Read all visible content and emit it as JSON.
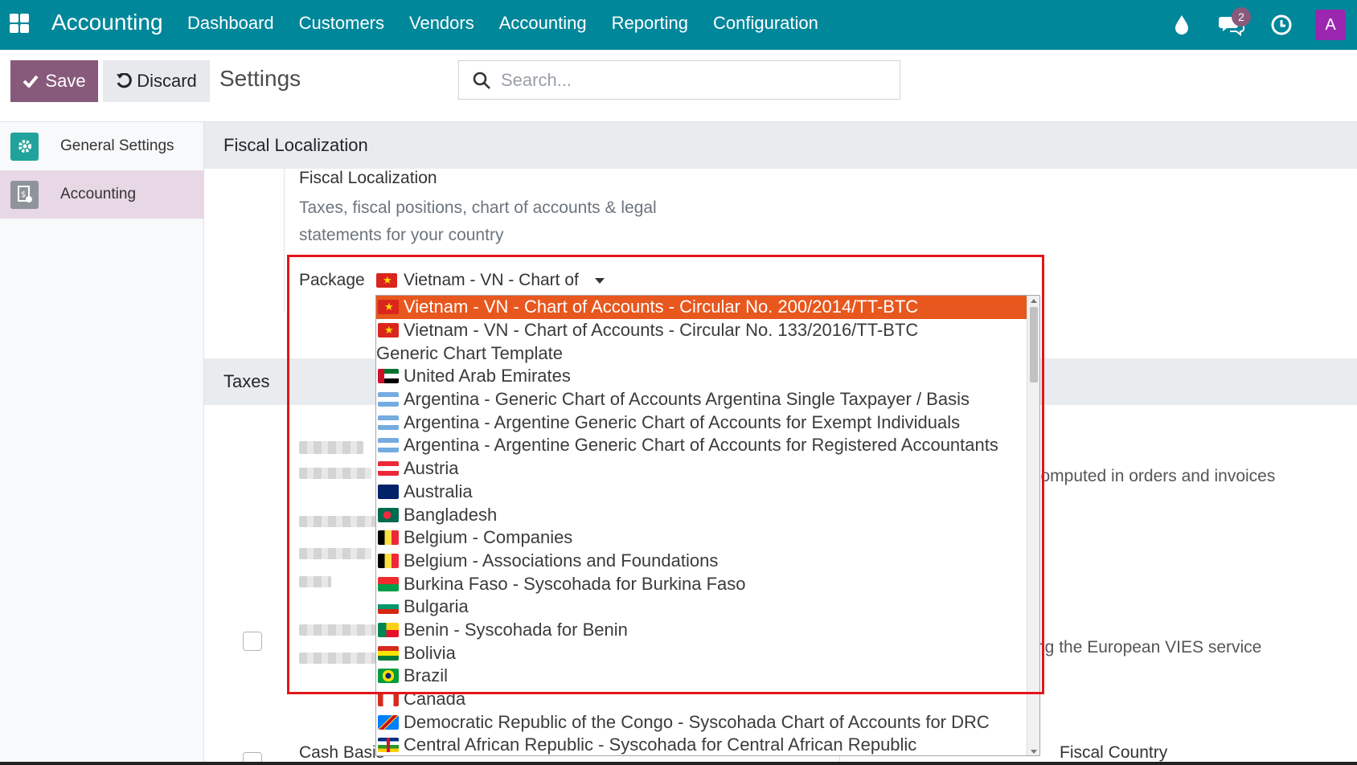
{
  "topbar": {
    "app_title": "Accounting",
    "menu": [
      "Dashboard",
      "Customers",
      "Vendors",
      "Accounting",
      "Reporting",
      "Configuration"
    ],
    "message_count": "2",
    "avatar_letter": "A"
  },
  "control": {
    "save_label": "Save",
    "discard_label": "Discard",
    "title": "Settings",
    "search_placeholder": "Search..."
  },
  "sidebar": {
    "items": [
      {
        "label": "General Settings"
      },
      {
        "label": "Accounting"
      }
    ]
  },
  "fiscal": {
    "section_title": "Fiscal Localization",
    "setting_title": "Fiscal Localization",
    "setting_desc": "Taxes, fiscal positions, chart of accounts & legal statements for your country",
    "package_label": "Package",
    "package_value": "Vietnam - VN - Chart of"
  },
  "taxes": {
    "section_title": "Taxes",
    "right_text_1": "computed in orders and invoices",
    "right_text_2": "ng the European VIES service",
    "cash_basis": "Cash Basis",
    "fiscal_country": "Fiscal Country"
  },
  "dropdown": {
    "items": [
      {
        "label": "Vietnam - VN - Chart of Accounts - Circular No. 200/2014/TT-BTC",
        "flag": "vn",
        "selected": true
      },
      {
        "label": "Vietnam - VN - Chart of Accounts - Circular No. 133/2016/TT-BTC",
        "flag": "vn"
      },
      {
        "label": "Generic Chart Template",
        "flag": ""
      },
      {
        "label": "United Arab Emirates",
        "flag": "ae"
      },
      {
        "label": "Argentina - Generic Chart of Accounts Argentina Single Taxpayer / Basis",
        "flag": "ar"
      },
      {
        "label": "Argentina - Argentine Generic Chart of Accounts for Exempt Individuals",
        "flag": "ar"
      },
      {
        "label": "Argentina - Argentine Generic Chart of Accounts for Registered Accountants",
        "flag": "ar"
      },
      {
        "label": "Austria",
        "flag": "at"
      },
      {
        "label": "Australia",
        "flag": "au"
      },
      {
        "label": "Bangladesh",
        "flag": "bd"
      },
      {
        "label": "Belgium - Companies",
        "flag": "be"
      },
      {
        "label": "Belgium - Associations and Foundations",
        "flag": "be"
      },
      {
        "label": "Burkina Faso - Syscohada for Burkina Faso",
        "flag": "bf"
      },
      {
        "label": "Bulgaria",
        "flag": "bg"
      },
      {
        "label": "Benin - Syscohada for Benin",
        "flag": "bj"
      },
      {
        "label": "Bolivia",
        "flag": "bo"
      },
      {
        "label": "Brazil",
        "flag": "br"
      },
      {
        "label": "Canada",
        "flag": "ca"
      },
      {
        "label": "Democratic Republic of the Congo - Syscohada Chart of Accounts for DRC",
        "flag": "cd"
      },
      {
        "label": "Central African Republic - Syscohada for Central African Republic",
        "flag": "cf"
      }
    ]
  },
  "colors": {
    "topbar": "#00879a",
    "primary": "#875a7b",
    "selected_option": "#e8571d",
    "highlight_box": "#e3151a"
  }
}
